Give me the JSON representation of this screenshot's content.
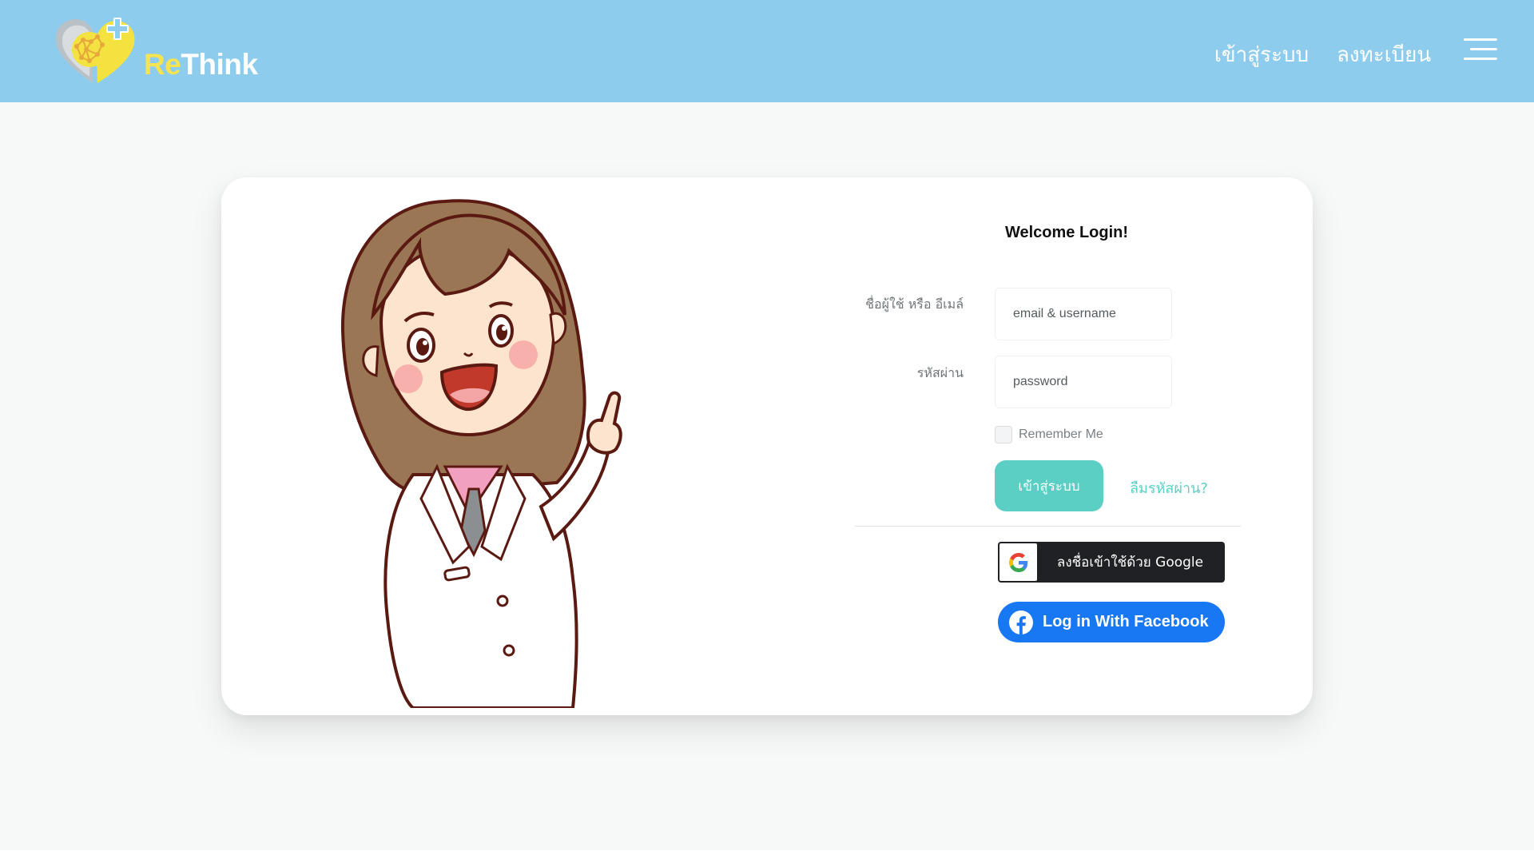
{
  "header": {
    "logo": {
      "re": "Re",
      "think": "Think"
    },
    "nav": {
      "login": "เข้าสู่ระบบ",
      "register": "ลงทะเบียน"
    },
    "menu_icon": "hamburger-icon"
  },
  "login": {
    "title": "Welcome Login!",
    "username_label": "ชื่อผู้ใช้ หรือ อีเมล์",
    "username_placeholder": "email & username",
    "password_label": "รหัสผ่าน",
    "password_placeholder": "password",
    "remember_label": "Remember Me",
    "submit_label": "เข้าสู่ระบบ",
    "forgot_label": "ลืมรหัสผ่าน?"
  },
  "social": {
    "google_label": "ลงชื่อเข้าใช้ด้วย Google",
    "facebook_label": "Log in With Facebook"
  },
  "colors": {
    "header_bg": "#8ecced",
    "accent": "#5ccfc4",
    "logo_yellow": "#f5e44f",
    "facebook_blue": "#1877f2",
    "google_dark": "#202124"
  }
}
